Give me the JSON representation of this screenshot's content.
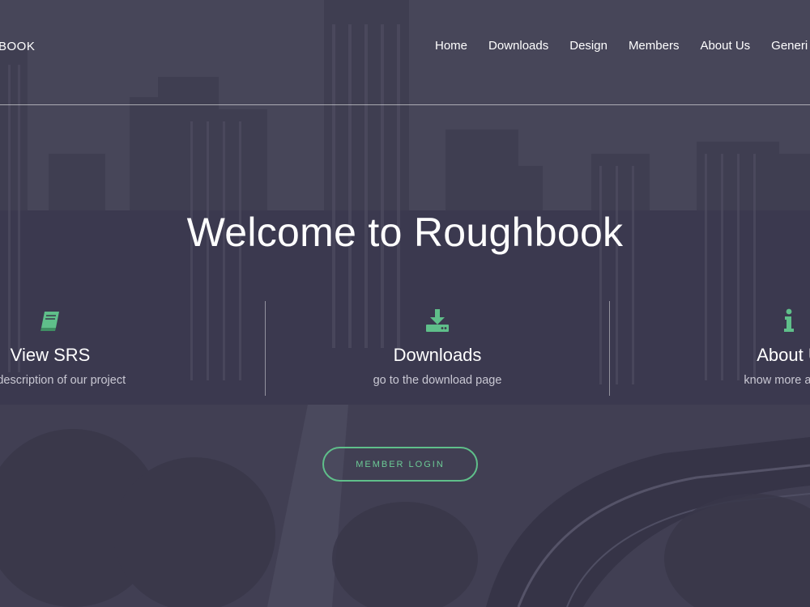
{
  "header": {
    "brand": "BOOK",
    "nav": [
      {
        "label": "Home"
      },
      {
        "label": "Downloads"
      },
      {
        "label": "Design"
      },
      {
        "label": "Members"
      },
      {
        "label": "About Us"
      },
      {
        "label": "Generi"
      }
    ]
  },
  "hero": {
    "title": "Welcome to Roughbook",
    "features": [
      {
        "title": "View SRS",
        "description": "lete description of our project",
        "icon": "book-icon"
      },
      {
        "title": "Downloads",
        "description": "go to the download page",
        "icon": "download-icon"
      },
      {
        "title": "About U",
        "description": "know more about",
        "icon": "info-icon"
      }
    ],
    "login_label": "MEMBER LOGIN"
  },
  "colors": {
    "accent": "#5fbf8a",
    "text": "#ffffff",
    "muted": "#c9c8d3"
  }
}
